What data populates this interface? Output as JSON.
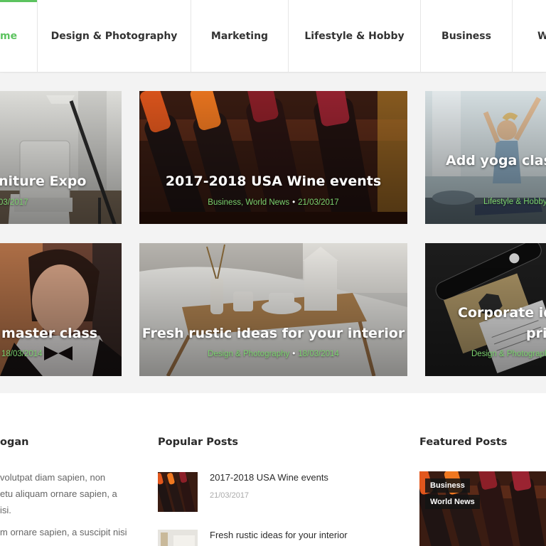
{
  "nav": {
    "items": [
      {
        "label": "Home",
        "visible": "me"
      },
      {
        "label": "Design & Photography"
      },
      {
        "label": "Marketing"
      },
      {
        "label": "Lifestyle & Hobby"
      },
      {
        "label": "Business"
      },
      {
        "label": "W",
        "visible": "W"
      }
    ]
  },
  "tiles": [
    {
      "title": "niture Expo",
      "meta_date": "03/2017"
    },
    {
      "title": "2017-2018 USA Wine events",
      "categories": "Business, World News",
      "sep": "•",
      "date": "21/03/2017"
    },
    {
      "title": "Add yoga classe",
      "categories": "Lifestyle & Hobby,"
    },
    {
      "title": "master class",
      "meta_date": "18/03/2014"
    },
    {
      "title": "Fresh rustic ideas for your interior",
      "categories": "Design & Photography",
      "sep": "•",
      "date": "18/03/2014"
    },
    {
      "title": "Corporate ide",
      "title2": "pri",
      "categories": "Design & Photograph"
    }
  ],
  "about": {
    "title": "ogan",
    "lines": [
      "volutpat diam sapien, non",
      "etu aliquam ornare sapien, a",
      "isi.",
      "m ornare sapien, a suscipit nisi"
    ]
  },
  "popular": {
    "title": "Popular Posts",
    "posts": [
      {
        "title": "2017-2018 USA Wine events",
        "date": "21/03/2017"
      },
      {
        "title": "Fresh rustic ideas for your interior",
        "date": ""
      }
    ]
  },
  "featured": {
    "title": "Featured Posts",
    "badges": [
      "Business",
      "World News"
    ]
  },
  "colors": {
    "accent": "#5cc35f",
    "meta": "#7cd36f"
  }
}
